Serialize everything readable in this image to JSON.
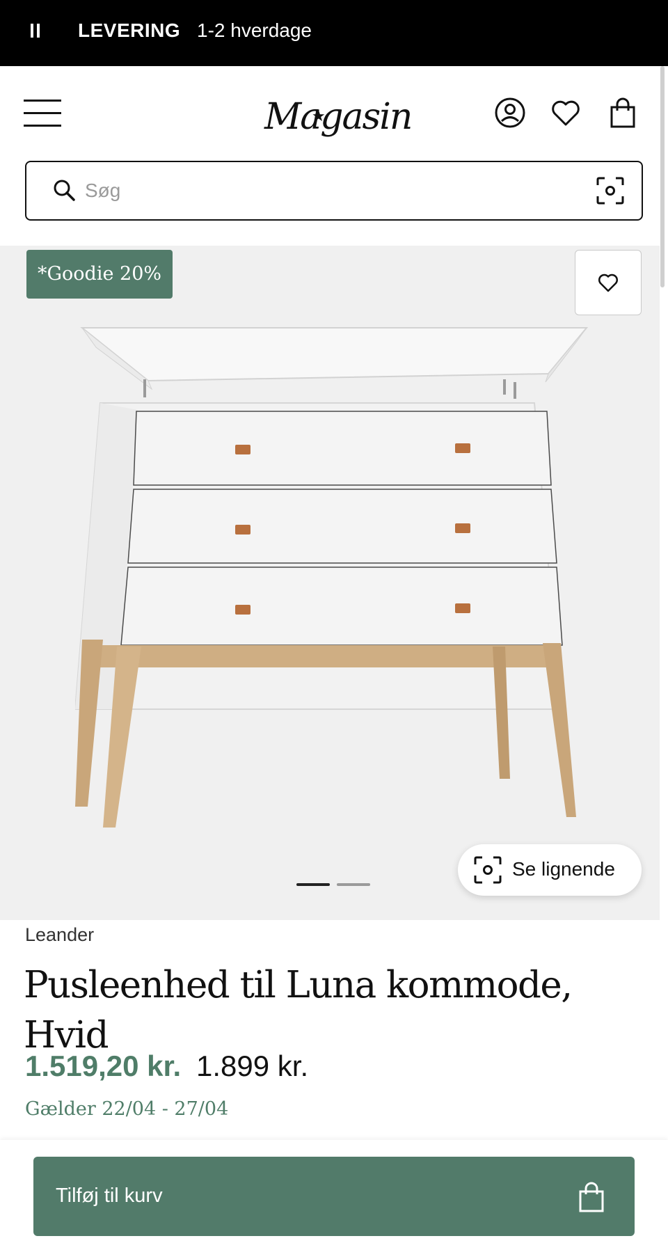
{
  "banner": {
    "title": "LEVERING",
    "subtitle": "1-2 hverdage"
  },
  "header": {
    "logo": "Magasin"
  },
  "search": {
    "placeholder": "Søg",
    "value": ""
  },
  "gallery": {
    "badge": "*Goodie 20%",
    "similar_label": "Se lignende",
    "slide_count": 2,
    "active_slide": 1
  },
  "product": {
    "brand": "Leander",
    "title": "Pusleenhed til Luna kommode, Hvid",
    "sale_price": "1.519,20 kr.",
    "original_price": "1.899 kr.",
    "validity": "Gælder 22/04 - 27/04"
  },
  "cart": {
    "add_label": "Tilføj til kurv"
  },
  "colors": {
    "accent": "#527b6a",
    "banner": "#000000",
    "price": "#4f7d68"
  },
  "icons": [
    "pause-icon",
    "menu-icon",
    "account-icon",
    "wishlist-icon",
    "bag-icon",
    "search-icon",
    "camera-scan-icon",
    "heart-icon",
    "shopping-bag-icon"
  ]
}
